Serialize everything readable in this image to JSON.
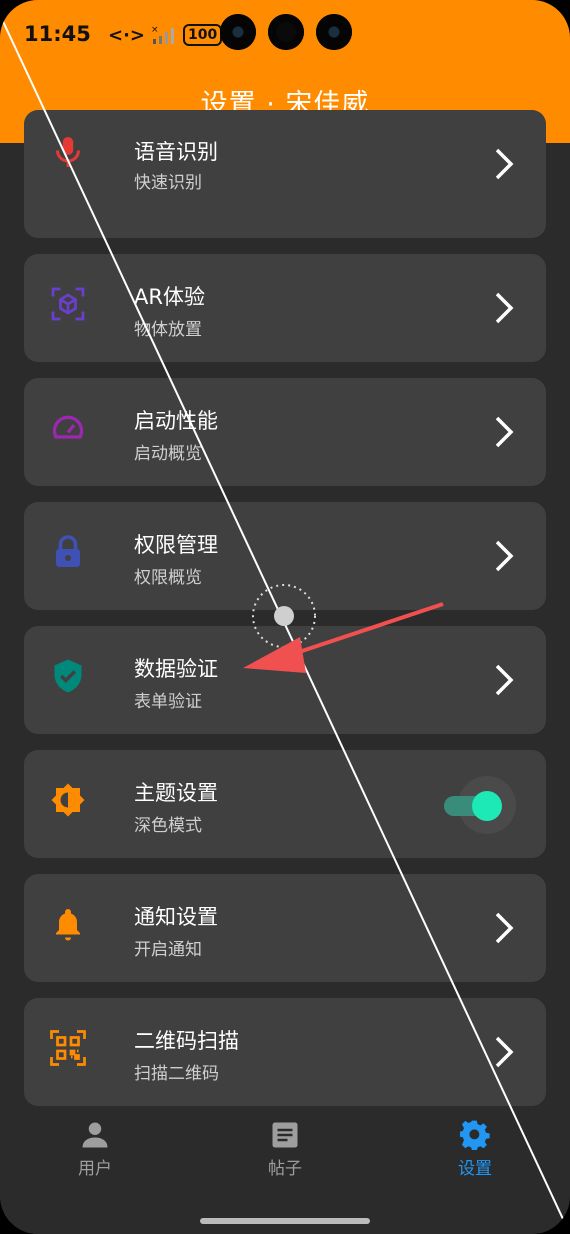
{
  "status_bar": {
    "time": "11:45",
    "network_icon": "<·>",
    "battery": "100"
  },
  "header": {
    "title": "设置 · 宋佳威",
    "bg_color": "#ff8c00"
  },
  "settings": [
    {
      "title": "语音识别",
      "subtitle": "快速识别",
      "icon": "microphone-icon",
      "icon_color": "#e53935",
      "control": "chevron"
    },
    {
      "title": "AR体验",
      "subtitle": "物体放置",
      "icon": "ar-cube-icon",
      "icon_color": "#6a3fd0",
      "control": "chevron"
    },
    {
      "title": "启动性能",
      "subtitle": "启动概览",
      "icon": "speedometer-icon",
      "icon_color": "#9c27b0",
      "control": "chevron"
    },
    {
      "title": "权限管理",
      "subtitle": "权限概览",
      "icon": "lock-icon",
      "icon_color": "#3f51b5",
      "control": "chevron"
    },
    {
      "title": "数据验证",
      "subtitle": "表单验证",
      "icon": "shield-check-icon",
      "icon_color": "#00897b",
      "control": "chevron"
    },
    {
      "title": "主题设置",
      "subtitle": "深色模式",
      "icon": "brightness-icon",
      "icon_color": "#ff8c00",
      "control": "toggle",
      "toggle_on": true
    },
    {
      "title": "通知设置",
      "subtitle": "开启通知",
      "icon": "bell-icon",
      "icon_color": "#ff8c00",
      "control": "chevron"
    },
    {
      "title": "二维码扫描",
      "subtitle": "扫描二维码",
      "icon": "qr-scan-icon",
      "icon_color": "#ff8c00",
      "control": "chevron"
    }
  ],
  "bottom_nav": [
    {
      "label": "用户",
      "icon": "person-icon",
      "active": false
    },
    {
      "label": "帖子",
      "icon": "article-icon",
      "active": false
    },
    {
      "label": "设置",
      "icon": "gear-icon",
      "active": true
    }
  ],
  "colors": {
    "accent": "#2196f3",
    "card_bg": "#404040",
    "page_bg": "#2b2b2b",
    "toggle_knob": "#1de9b6"
  }
}
